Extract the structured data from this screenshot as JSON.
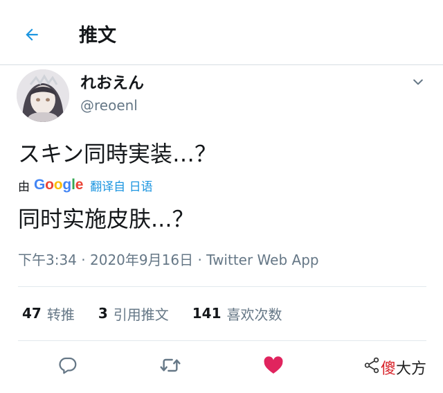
{
  "header": {
    "title": "推文"
  },
  "user": {
    "display_name": "れおえん",
    "handle": "@reoenl"
  },
  "tweet": {
    "text": "スキン同時実装…？"
  },
  "translation": {
    "prefix": "由",
    "logo": [
      "G",
      "o",
      "o",
      "g",
      "l",
      "e"
    ],
    "logo_colors": [
      "#4285f4",
      "#ea4335",
      "#fbbc05",
      "#4285f4",
      "#34a853",
      "#ea4335"
    ],
    "link": "翻译自 日语",
    "text": "同时实施皮肤...？"
  },
  "meta": {
    "time": "下午3:34",
    "date": "2020年9月16日",
    "source": "Twitter Web App"
  },
  "stats": {
    "retweets": {
      "count": "47",
      "label": "转推"
    },
    "quotes": {
      "count": "3",
      "label": "引用推文"
    },
    "likes": {
      "count": "141",
      "label": "喜欢次数"
    }
  },
  "icons": {
    "back": "arrow-left-icon",
    "caret": "chevron-down-icon",
    "reply": "reply-icon",
    "retweet": "retweet-icon",
    "like": "heart-icon",
    "share": "share-icon"
  },
  "colors": {
    "accent": "#1b95e0",
    "like": "#e0245e",
    "muted": "#657786"
  },
  "watermark": {
    "first": "傻",
    "rest": "大方"
  }
}
